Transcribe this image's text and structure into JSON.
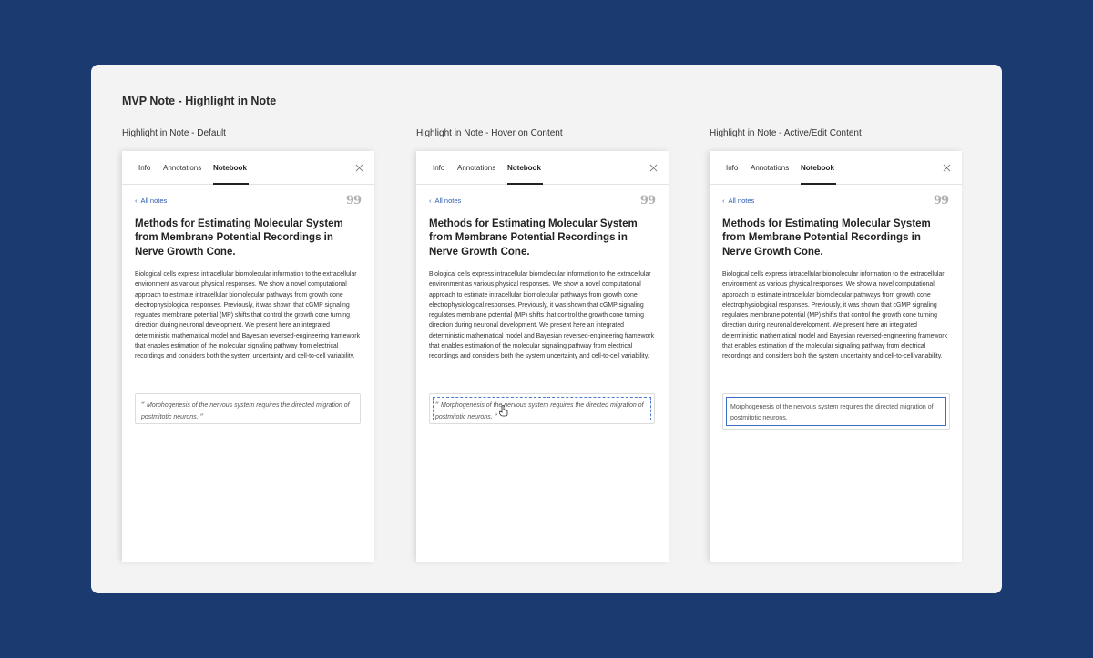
{
  "board": {
    "title": "MVP Note - Highlight in Note"
  },
  "variants": [
    {
      "label": "Highlight in Note - Default"
    },
    {
      "label": "Highlight in Note - Hover on Content"
    },
    {
      "label": "Highlight in Note - Active/Edit Content"
    }
  ],
  "panel": {
    "tabs": [
      {
        "label": "Info"
      },
      {
        "label": "Annotations"
      },
      {
        "label": "Notebook"
      }
    ],
    "active_tab": "Notebook",
    "back_link": "All notes",
    "icons": {
      "close": "close-icon",
      "quote": "quote-icon",
      "back": "chevron-left-icon"
    },
    "quote_glyph": "99",
    "doc_title": "Methods for Estimating Molecular System from Membrane Potential Recordings in Nerve Growth Cone.",
    "doc_body": "Biological cells express intracellular biomolecular information to the extracellular environment as various physical responses. We show a novel computational approach to estimate intracellular biomolecular pathways from growth cone electrophysiological responses. Previously, it was shown that cGMP signaling regulates membrane potential (MP) shifts that control the growth cone turning direction during neuronal development. We present here an integrated deterministic mathematical model and Bayesian reversed-engineering framework that enables estimation of the molecular signaling pathway from electrical recordings and considers both the system uncertainty and cell-to-cell variability.",
    "highlight_text": "Morphogenesis of the nervous system requires the directed migration of postmitotic neurons.",
    "open_quote": "“",
    "close_quote": "”"
  },
  "colors": {
    "background": "#1b3a6f",
    "link": "#2c5ab0",
    "edit_border": "#3b6fc4",
    "hover_border": "#4b7bc9"
  }
}
